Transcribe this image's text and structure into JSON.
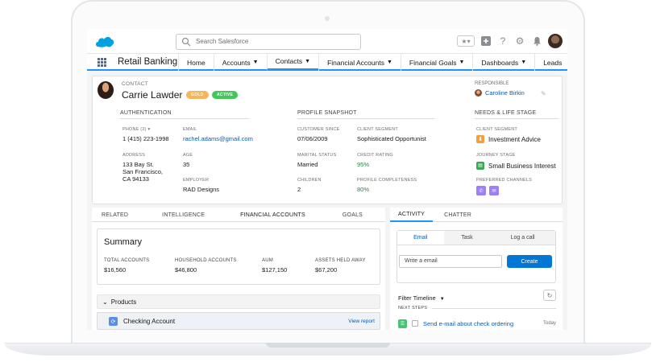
{
  "header": {
    "search_placeholder": "Search Salesforce"
  },
  "nav": {
    "app_name": "Retail Banking",
    "tabs": [
      {
        "label": "Home",
        "dropdown": false
      },
      {
        "label": "Accounts",
        "dropdown": true
      },
      {
        "label": "Contacts",
        "dropdown": true,
        "active": true
      },
      {
        "label": "Financial Accounts",
        "dropdown": true
      },
      {
        "label": "Financial Goals",
        "dropdown": true
      },
      {
        "label": "Dashboards",
        "dropdown": true
      },
      {
        "label": "Leads",
        "dropdown": false
      }
    ]
  },
  "record": {
    "type": "CONTACT",
    "name": "Carrie Lawder",
    "badges": {
      "gold": "GOLD",
      "active": "ACTIVE"
    },
    "responsible_label": "RESPONSIBLE",
    "responsible_name": "Caroline Birkin",
    "sections": {
      "authentication": "AUTHENTICATION",
      "profile": "PROFILE SNAPSHOT",
      "needs": "NEEDS & LIFE STAGE"
    },
    "phone_label": "PHONE (2) ▾",
    "phone": "1 (415) 223-1998",
    "email_label": "EMAIL",
    "email": "rachel.adams@gmail.com",
    "address_label": "ADDRESS",
    "address_line1": "133 Bay St.",
    "address_line2": "San Francisco,",
    "address_line3": "CA 94133",
    "age_label": "AGE",
    "age": "35",
    "employer_label": "EMPLOYER",
    "employer": "RAD Designs",
    "customer_since_label": "CUSTOMER SINCE",
    "customer_since": "07/06/2009",
    "client_segment_label": "CLIENT SEGMENT",
    "client_segment": "Sophisticated Opportunist",
    "marital_label": "MARITAL STATUS",
    "marital": "Married",
    "credit_label": "CREDIT RATING",
    "credit": "95%",
    "children_label": "CHILDREN",
    "children": "2",
    "completeness_label": "PROFILE COMPLETENESS",
    "completeness": "80%",
    "needs_segment_label": "CLIENT SEGMENT",
    "needs_segment": "Investment Advice",
    "journey_label": "JOURNEY STAGE",
    "journey": "Small Business Interest",
    "channels_label": "PREFERRED CHANNELS"
  },
  "left_tabs": [
    "RELATED",
    "INTELLIGENCE",
    "FINANCIAL ACCOUNTS",
    "GOALS"
  ],
  "summary": {
    "title": "Summary",
    "total_accounts_label": "TOTAL ACCOUNTS",
    "total_accounts": "$16,560",
    "household_label": "HOUSEHOLD ACCOUNTS",
    "household": "$46,800",
    "aum_label": "AUM",
    "aum": "$127,150",
    "held_away_label": "ASSETS HELD AWAY",
    "held_away": "$67,200"
  },
  "products": {
    "label": "Products",
    "checking": "Checking Account",
    "view_report": "View report"
  },
  "right_tabs": [
    "ACTIVITY",
    "CHATTER"
  ],
  "activity": {
    "tabs": [
      "Email",
      "Task",
      "Log a call"
    ],
    "email_placeholder": "Write a email",
    "create": "Create",
    "filter": "Filter Timeline",
    "next_steps": "NEXT STEPS",
    "task": "Send e-mail about check ordering",
    "task_date": "Today"
  },
  "colors": {
    "brand_blue": "#0176d3",
    "nav_accent": "#1b96ff",
    "gold_badge": "#f5b55b",
    "active_badge": "#45c65a",
    "positive_green": "#2e844a"
  }
}
